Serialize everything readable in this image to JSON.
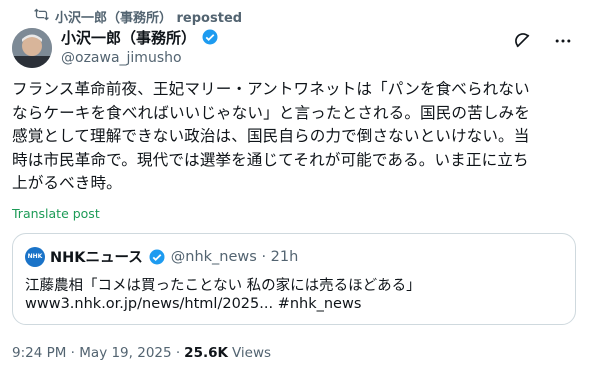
{
  "repost": {
    "text": "小沢一郎（事務所） reposted"
  },
  "author": {
    "name": "小沢一郎（事務所）",
    "handle": "@ozawa_jimusho"
  },
  "post": {
    "text": "フランス革命前夜、王妃マリー・アントワネットは「パンを食べられない\nならケーキを食べればいいじゃない」と言ったとされる。国民の苦しみを\n感覚として理解できない政治は、国民自らの力で倒さないといけない。当\n時は市民革命で。現代では選挙を通じてそれが可能である。いま正に立ち\n上がるべき時。",
    "translate_label": "Translate post"
  },
  "quote": {
    "logo_text": "NHK",
    "name": "NHKニュース",
    "meta": "@nhk_news · 21h",
    "line1": "江藤農相「コメは買ったことない 私の家には売るほどある」",
    "line2": "www3.nhk.or.jp/news/html/2025... #nhk_news"
  },
  "footer": {
    "timestamp": "9:24 PM · May 19, 2025 ·",
    "views_count": "25.6K",
    "views_label": "Views"
  },
  "colors": {
    "accent": "#1d9bf0",
    "translate": "#1d9b57",
    "muted": "#536471"
  }
}
